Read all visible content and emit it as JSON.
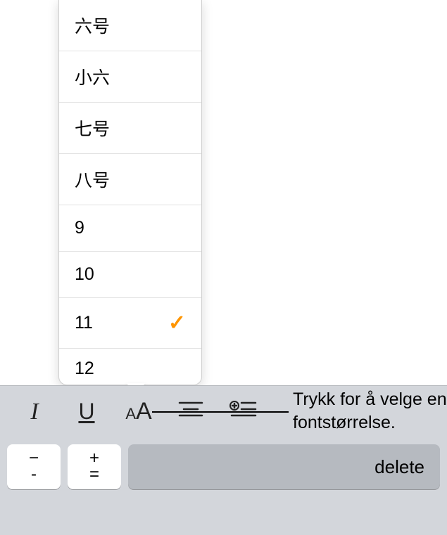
{
  "popover": {
    "items": [
      {
        "label": "六号",
        "selected": false
      },
      {
        "label": "小六",
        "selected": false
      },
      {
        "label": "七号",
        "selected": false
      },
      {
        "label": "八号",
        "selected": false
      },
      {
        "label": "9",
        "selected": false
      },
      {
        "label": "10",
        "selected": false
      },
      {
        "label": "11",
        "selected": true
      },
      {
        "label": "12",
        "selected": false
      }
    ],
    "checkmark": "✓"
  },
  "toolbar": {
    "italic": "I",
    "underline": "U",
    "fontsize": "AA",
    "align": "align",
    "insert": "insert"
  },
  "keyboard": {
    "key1_top": "−",
    "key1_bottom": "-",
    "key2_top": "+",
    "key2_bottom": "=",
    "delete": "delete"
  },
  "callout": {
    "text": "Trykk for å velge en fontstørrelse."
  }
}
